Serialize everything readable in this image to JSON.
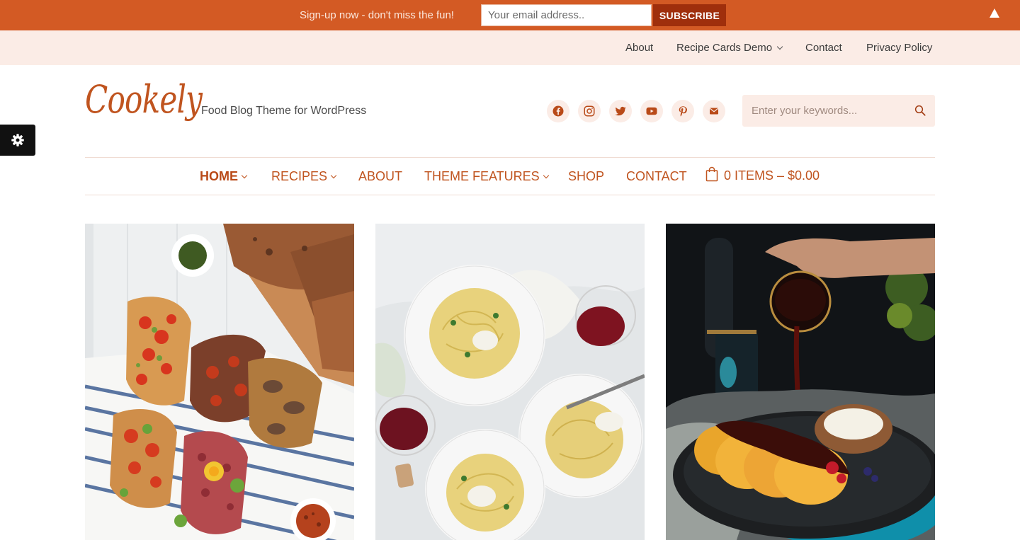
{
  "promo": {
    "text": "Sign-up now - don't miss the fun!",
    "email_placeholder": "Your email address..",
    "subscribe_label": "SUBSCRIBE",
    "toggle_icon": "triangle-up-icon"
  },
  "topnav": {
    "items": [
      {
        "label": "About"
      },
      {
        "label": "Recipe Cards Demo",
        "has_dropdown": true
      },
      {
        "label": "Contact"
      },
      {
        "label": "Privacy Policy"
      }
    ]
  },
  "header": {
    "logo": "Cookely",
    "tagline": "Food Blog Theme for WordPress",
    "social_icons": [
      "facebook-icon",
      "instagram-icon",
      "twitter-icon",
      "youtube-icon",
      "pinterest-icon",
      "email-icon"
    ],
    "search_placeholder": "Enter your keywords..."
  },
  "mainnav": {
    "items": [
      {
        "label": "HOME",
        "active": true,
        "has_dropdown": true
      },
      {
        "label": "RECIPES",
        "has_dropdown": true
      },
      {
        "label": "ABOUT"
      },
      {
        "label": "THEME FEATURES",
        "has_dropdown": true
      },
      {
        "label": "SHOP"
      },
      {
        "label": "CONTACT"
      }
    ],
    "cart_label": "0 ITEMS – $0.00"
  },
  "colors": {
    "accent": "#c0541f",
    "promo_bg": "#d35a24",
    "subscribe_bg": "#9f2f0c",
    "soft_bg": "#fbece6"
  }
}
